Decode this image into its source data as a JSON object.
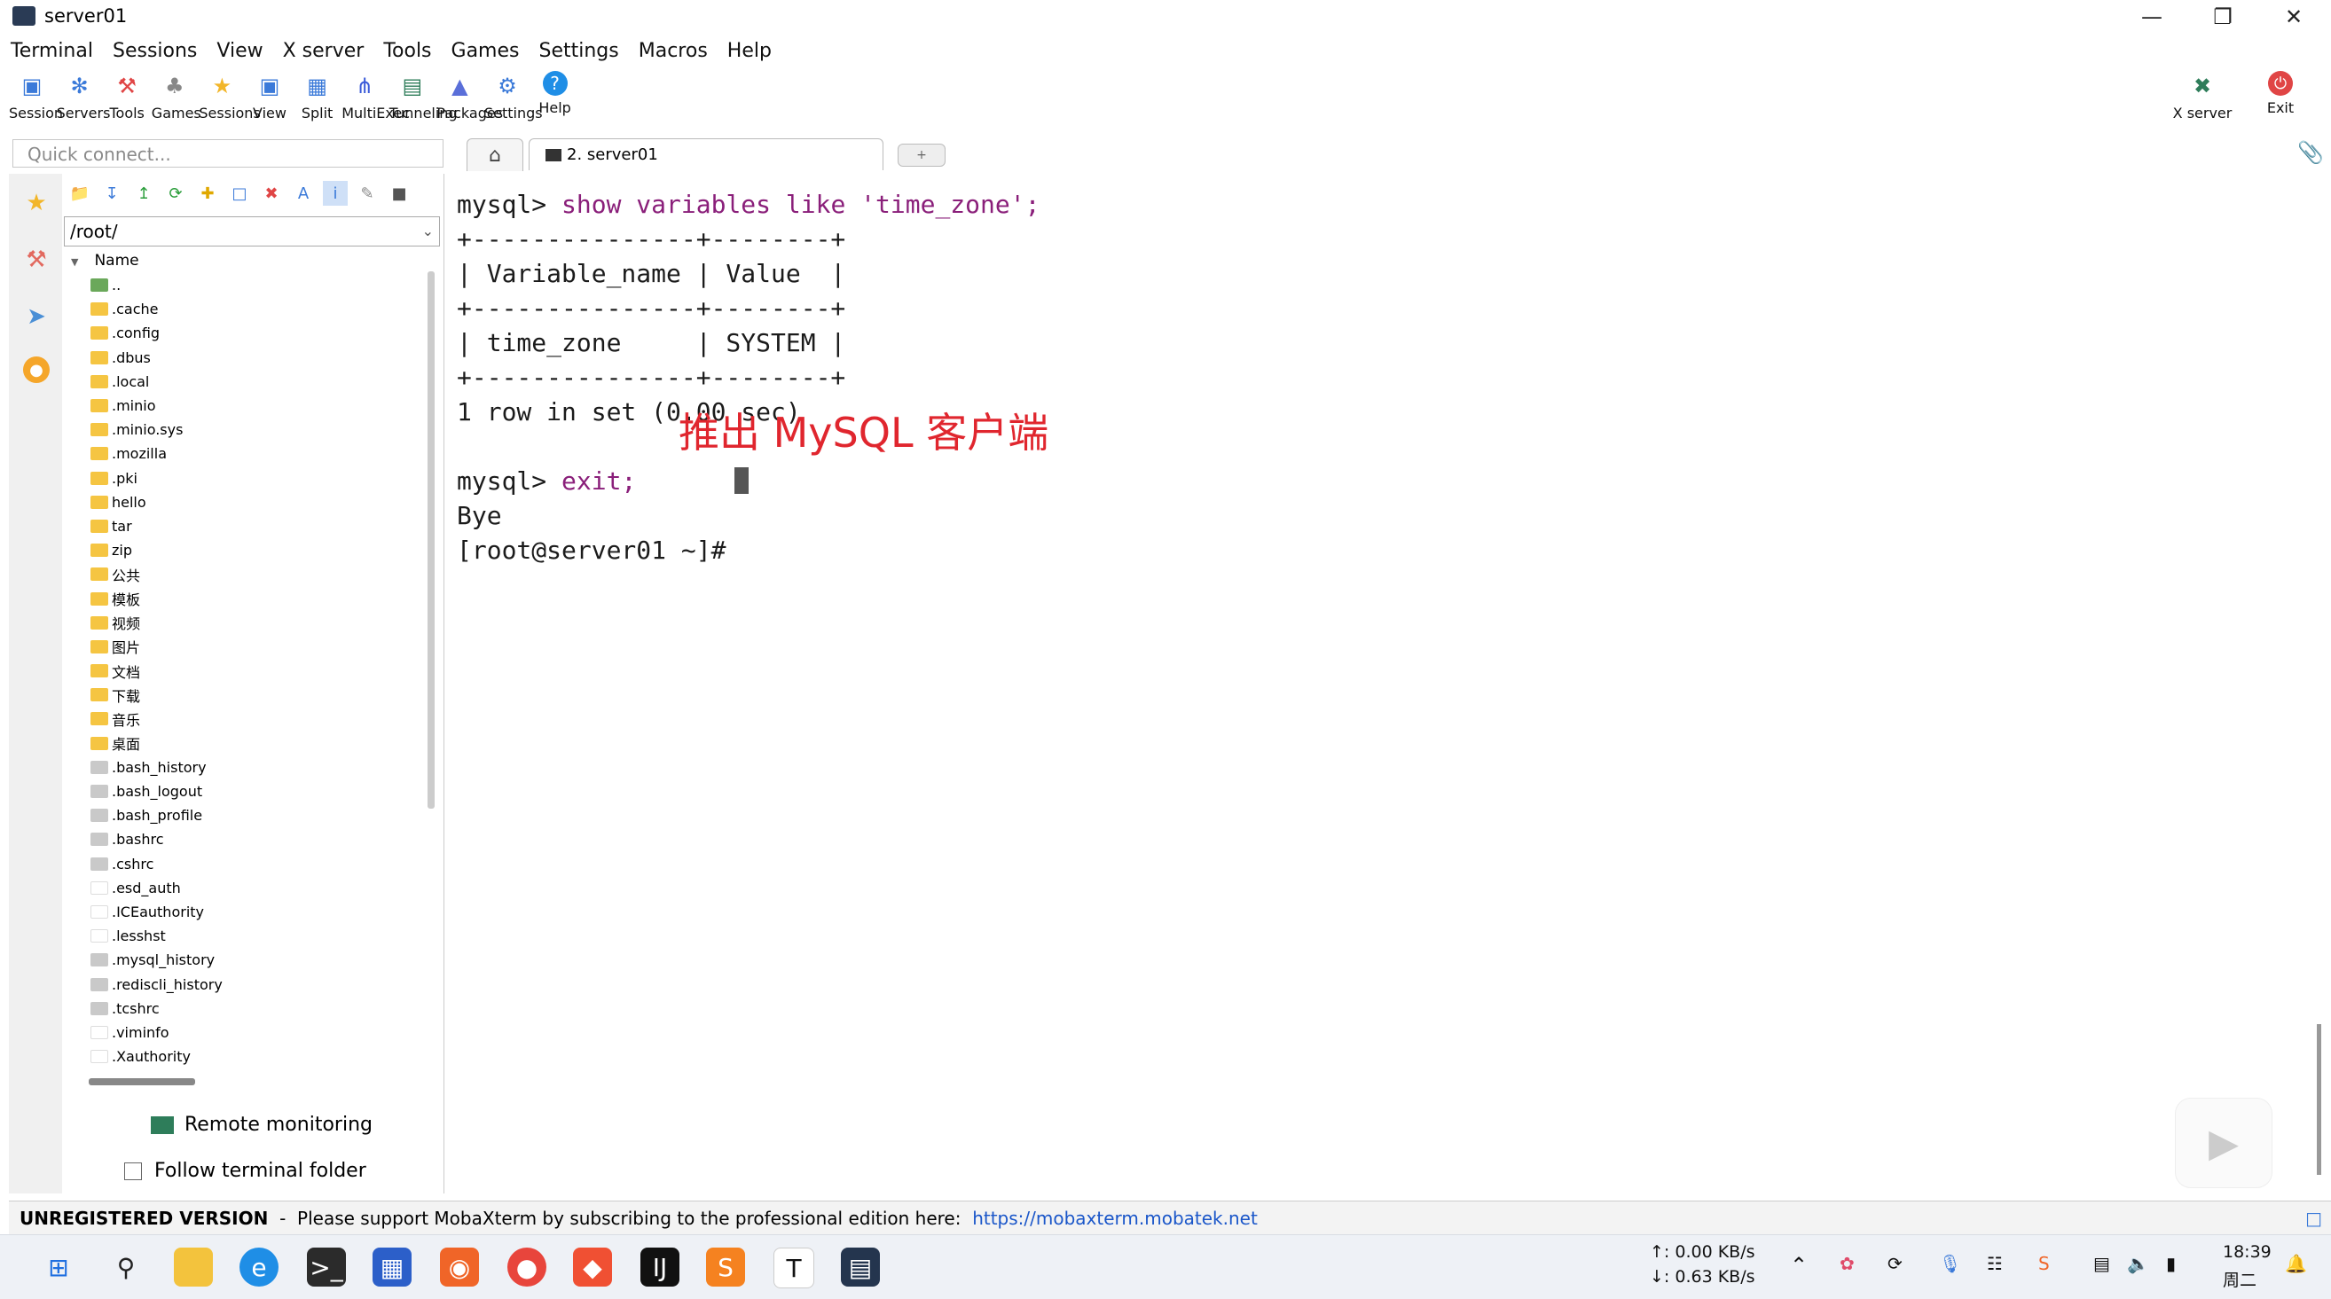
{
  "window": {
    "title": "server01"
  },
  "menu": [
    "Terminal",
    "Sessions",
    "View",
    "X server",
    "Tools",
    "Games",
    "Settings",
    "Macros",
    "Help"
  ],
  "toolbar": [
    {
      "label": "Session",
      "icon": "session-icon"
    },
    {
      "label": "Servers",
      "icon": "servers-icon"
    },
    {
      "label": "Tools",
      "icon": "tools-icon"
    },
    {
      "label": "Games",
      "icon": "games-icon"
    },
    {
      "label": "Sessions",
      "icon": "star-icon"
    },
    {
      "label": "View",
      "icon": "view-icon"
    },
    {
      "label": "Split",
      "icon": "split-icon"
    },
    {
      "label": "MultiExec",
      "icon": "multiexec-icon"
    },
    {
      "label": "Tunneling",
      "icon": "tunneling-icon"
    },
    {
      "label": "Packages",
      "icon": "packages-icon"
    },
    {
      "label": "Settings",
      "icon": "settings-icon"
    },
    {
      "label": "Help",
      "icon": "help-icon"
    }
  ],
  "toolbar_right": [
    {
      "label": "X server",
      "icon": "x-server-icon"
    },
    {
      "label": "Exit",
      "icon": "power-icon"
    }
  ],
  "quick_connect": {
    "placeholder": "Quick connect..."
  },
  "tabs": {
    "active": "2. server01"
  },
  "sftp": {
    "path": "/root/",
    "column": "Name",
    "files": [
      {
        "name": "..",
        "kind": "parent"
      },
      {
        "name": ".cache",
        "kind": "folder"
      },
      {
        "name": ".config",
        "kind": "folder"
      },
      {
        "name": ".dbus",
        "kind": "folder"
      },
      {
        "name": ".local",
        "kind": "folder"
      },
      {
        "name": ".minio",
        "kind": "folder"
      },
      {
        "name": ".minio.sys",
        "kind": "folder"
      },
      {
        "name": ".mozilla",
        "kind": "folder"
      },
      {
        "name": ".pki",
        "kind": "folder"
      },
      {
        "name": "hello",
        "kind": "folder"
      },
      {
        "name": "tar",
        "kind": "folder"
      },
      {
        "name": "zip",
        "kind": "folder"
      },
      {
        "name": "公共",
        "kind": "folder"
      },
      {
        "name": "模板",
        "kind": "folder"
      },
      {
        "name": "视频",
        "kind": "folder"
      },
      {
        "name": "图片",
        "kind": "folder"
      },
      {
        "name": "文档",
        "kind": "folder"
      },
      {
        "name": "下载",
        "kind": "folder"
      },
      {
        "name": "音乐",
        "kind": "folder"
      },
      {
        "name": "桌面",
        "kind": "folder"
      },
      {
        "name": ".bash_history",
        "kind": "file"
      },
      {
        "name": ".bash_logout",
        "kind": "file"
      },
      {
        "name": ".bash_profile",
        "kind": "file"
      },
      {
        "name": ".bashrc",
        "kind": "file"
      },
      {
        "name": ".cshrc",
        "kind": "file"
      },
      {
        "name": ".esd_auth",
        "kind": "blank"
      },
      {
        "name": ".ICEauthority",
        "kind": "blank"
      },
      {
        "name": ".lesshst",
        "kind": "blank"
      },
      {
        "name": ".mysql_history",
        "kind": "file"
      },
      {
        "name": ".rediscli_history",
        "kind": "file"
      },
      {
        "name": ".tcshrc",
        "kind": "file"
      },
      {
        "name": ".viminfo",
        "kind": "blank"
      },
      {
        "name": ".Xauthority",
        "kind": "blank"
      }
    ],
    "remote_monitoring": "Remote monitoring",
    "follow_terminal": "Follow terminal folder"
  },
  "terminal": {
    "lines": [
      {
        "prompt": "mysql> ",
        "cmd": "show variables like 'time_zone';"
      },
      {
        "text": "+---------------+--------+"
      },
      {
        "text": "| Variable_name | Value  |"
      },
      {
        "text": "+---------------+--------+"
      },
      {
        "text": "| time_zone     | SYSTEM |"
      },
      {
        "text": "+---------------+--------+"
      },
      {
        "text": "1 row in set (0.00 sec)"
      },
      {
        "text": ""
      },
      {
        "prompt": "mysql> ",
        "cmd": "exit;"
      },
      {
        "text": "Bye"
      },
      {
        "text": "[root@server01 ~]# "
      }
    ],
    "overlay": "推出 MySQL 客户端"
  },
  "status": {
    "unregistered": "UNREGISTERED VERSION",
    "message": "  -  Please support MobaXterm by subscribing to the professional edition here:  ",
    "link": "https://mobaxterm.mobatek.net"
  },
  "taskbar": {
    "net_up": "↑: 0.00 KB/s",
    "net_down": "↓: 0.63 KB/s",
    "time": "18:39",
    "day": "周二"
  }
}
